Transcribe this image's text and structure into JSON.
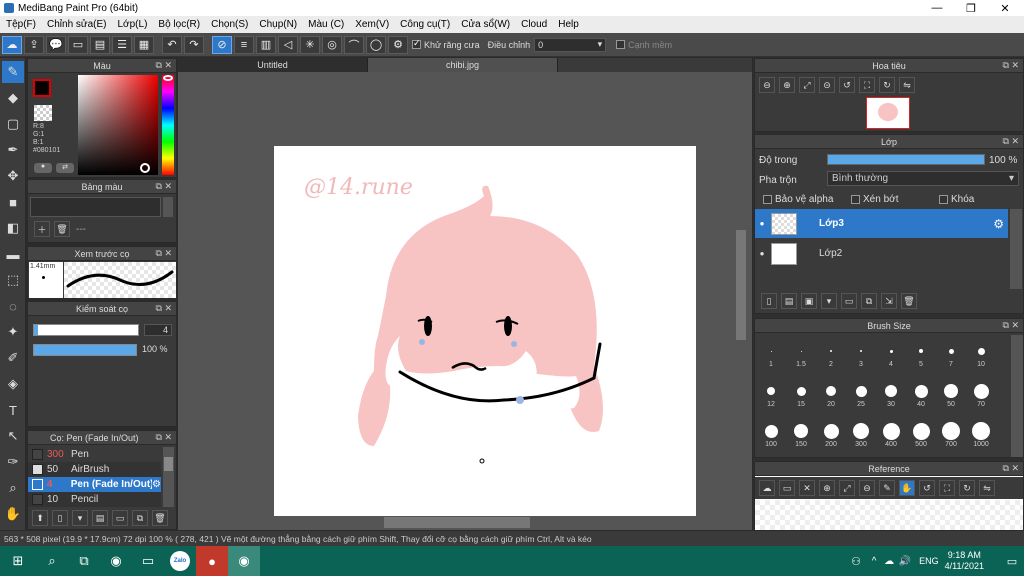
{
  "window": {
    "title": "MediBang Paint Pro (64bit)",
    "minimize": "—",
    "maximize": "❐",
    "close": "✕"
  },
  "menu": [
    "Tệp(F)",
    "Chỉnh sửa(E)",
    "Lớp(L)",
    "Bộ lọc(R)",
    "Chọn(S)",
    "Chụp(N)",
    "Màu (C)",
    "Xem(V)",
    "Công cụ(T)",
    "Cửa sổ(W)",
    "Cloud",
    "Help"
  ],
  "toolbar": {
    "antialias_label": "Khử răng cưa",
    "correction_label": "Điều chỉnh",
    "correction_value": "0",
    "edge_label": "Cạnh mềm"
  },
  "color_panel": {
    "title": "Màu",
    "r": "R:8",
    "g": "G:1",
    "b": "B:1",
    "hex": "#080101",
    "primary_color": "#080101"
  },
  "palette_panel": {
    "title": "Bảng màu",
    "dashes": "---"
  },
  "brush_preview_panel": {
    "title": "Xem trước cọ",
    "size": "1.41mm"
  },
  "control_panel": {
    "title": "Kiểm soát cọ",
    "size_value": "4",
    "opacity_value": "100 %",
    "opacity": 1.0
  },
  "brush_list": {
    "title": "Cọ: Pen (Fade In/Out)",
    "items": [
      {
        "size": "300",
        "name": "Pen",
        "selected": false
      },
      {
        "size": "50",
        "name": "AirBrush",
        "selected": false
      },
      {
        "size": "4",
        "name": "Pen (Fade In/Out)",
        "selected": true
      },
      {
        "size": "10",
        "name": "Pencil",
        "selected": false
      }
    ]
  },
  "tabs": [
    {
      "label": "Untitled",
      "active": false
    },
    {
      "label": "chibi.jpg",
      "active": true
    }
  ],
  "canvas": {
    "watermark": "@14.rune"
  },
  "navigator_panel": {
    "title": "Hoa tiêu"
  },
  "layer_panel": {
    "title": "Lớp",
    "opacity_label": "Độ trong",
    "opacity_value": "100 %",
    "blend_label": "Pha trộn",
    "blend_value": "Bình thường",
    "protect_alpha": "Bảo vệ alpha",
    "clipping": "Xén bớt",
    "lock": "Khóa",
    "layers": [
      {
        "name": "Lớp3",
        "selected": true
      },
      {
        "name": "Lớp2",
        "selected": false
      }
    ]
  },
  "brush_size_panel": {
    "title": "Brush Size",
    "sizes": [
      "1",
      "1.5",
      "2",
      "3",
      "4",
      "5",
      "7",
      "10",
      "12",
      "15",
      "20",
      "25",
      "30",
      "40",
      "50",
      "70",
      "100",
      "150",
      "200",
      "300",
      "400",
      "500",
      "700",
      "1000"
    ]
  },
  "reference_panel": {
    "title": "Reference"
  },
  "status": {
    "dimensions": "563 * 508 pixel",
    "physical": "(19.9 * 17.9cm)",
    "dpi": "72 dpi",
    "zoom": "100 %",
    "coords": "( 278, 421 )",
    "hint": "Vẽ một đường thẳng bằng cách giữ phím Shift, Thay đổi cỡ cọ bằng cách giữ phím Ctrl, Alt và kéo"
  },
  "taskbar": {
    "language": "ENG",
    "time": "9:18 AM",
    "date": "4/11/2021",
    "zalo": "Zalo"
  },
  "colors": {
    "accent": "#2d78c8",
    "taskbar": "#0a6354",
    "hair": "#f8c3c3"
  }
}
